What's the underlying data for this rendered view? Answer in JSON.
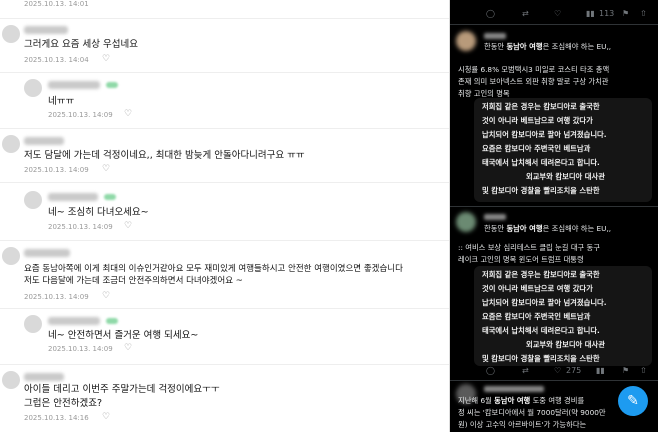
{
  "comments": [
    {
      "text": "",
      "date": "2025.10.13. 14:01"
    },
    {
      "text": "그러게요 요즘 세상 우섭네요",
      "date": "2025.10.13. 14:04"
    },
    {
      "text": "네ㅠㅠ",
      "date": "2025.10.13. 14:09"
    },
    {
      "text": "저도 담달에 가는데 걱정이네요,, 최대한 밤늦게 안돌아다니려구요 ㅠㅠ",
      "date": "2025.10.13. 14:09"
    },
    {
      "text": "네~ 조심히 다녀오세요~",
      "date": "2025.10.13. 14:09"
    },
    {
      "text": "요즘 동남아쪽에 이게 최대의 이슈인거같아요 모두 재미있게 여행들하시고 안전한 여행이였으면 좋겠습니다",
      "text2": "저도 다음달에 가는데 조금더 안전주의하면서 다녀야겠어요 ~",
      "date": "2025.10.13. 14:09"
    },
    {
      "text": "네~ 안전하면서 즐거운 여행 되세요~",
      "date": "2025.10.13. 14:09"
    },
    {
      "text": "아이들 데리고 이번주 주말가는데 걱정이에요ㅜㅜ",
      "text2": "그럽은 안전하겠죠?",
      "date": "2025.10.13. 14:16"
    }
  ],
  "icons": {
    "heart": "heart-icon"
  },
  "right": {
    "top_actions": {
      "views": "113"
    },
    "tweet1": {
      "title_pre": "한동안 ",
      "title_bold": "동남아 여행",
      "title_post": "은 조심해야 하는 EU,,",
      "body1": "시청률 6.8% 모범택시3 미일로 코스티 타조 총액",
      "body2": "존재 의미 보아넥스트 외판 취향 말로 구상 가치관",
      "body3": "취향 고인의 명복",
      "img_lines": [
        "저희집 같은 경우는 캄보디아로 출국한",
        "것이 아니라 베트남으로 여행 갔다가",
        "납치되어 캄보디아로 팔아 넘겨졌습니다.",
        "요즘은 캄보디아 주변국인 베트남과",
        "태국에서 납치해서 데려온다고 합니다.",
        "외교부와 캄보디아 대사관",
        "및 캄보디아 경찰을 빨리조치을 스탄한"
      ]
    },
    "tweet2": {
      "title_pre": "한동안 ",
      "title_bold": "동남아 여행",
      "title_post": "은 조심해야 하는 EU,,",
      "body1": ":: 여비스 보상 심리테스트 클립 눈길 대구 동구",
      "body2": "레이크 고인의 명복 윈도어 트럼프 대통령",
      "img_lines": [
        "저희집 같은 경우는 캄보디아로 출국한",
        "것이 아니라 베트남으로 여행 갔다가",
        "납치되어 캄보디아로 팔아 넘겨졌습니다.",
        "요즘은 캄보디아 주변국인 베트남과",
        "태국에서 납치해서 데려온다고 합니다.",
        "외교부와 캄보디아 대사관",
        "및 캄보디아 경찰을 빨리조치을 스탄한"
      ],
      "reposts": "",
      "likes": "275"
    },
    "tweet3": {
      "line1_pre": "지난해 6월 ",
      "line1_bold": "동남아 여행",
      "line1_post": " 도중 여행 경비를",
      "line2": "정 씨는 '캄보디아에서 월 7000달러(약 9000만",
      "line3": "원) 이상 고수익 아르바이트'가 가능하다는"
    }
  }
}
